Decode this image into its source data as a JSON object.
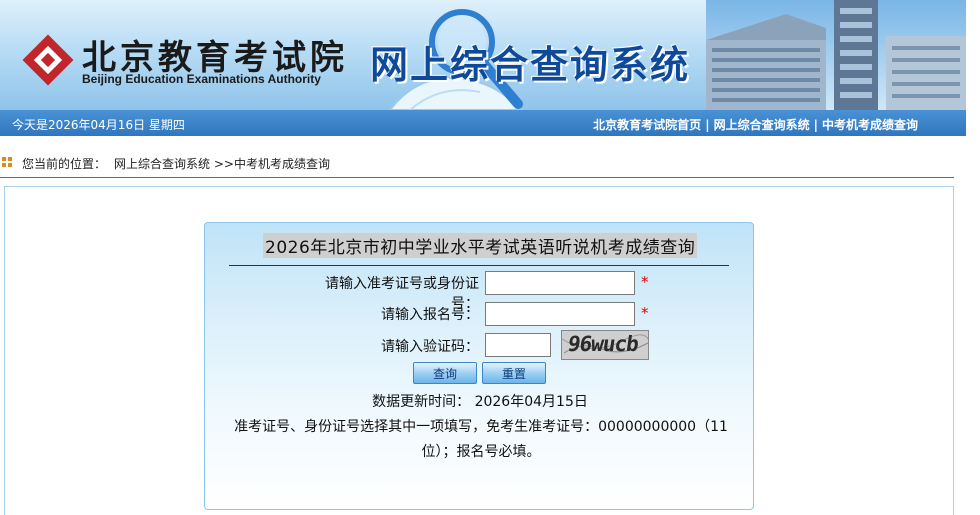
{
  "header": {
    "org_name_cn": "北京教育考试院",
    "org_name_en": "Beijing Education Examinations Authority",
    "system_title": "网上综合查询系统"
  },
  "topbar": {
    "date_text": "今天是2026年04月16日  星期四",
    "links": [
      "北京教育考试院首页",
      "网上综合查询系统",
      "中考机考成绩查询"
    ],
    "separator": "|"
  },
  "breadcrumb": {
    "lead": "您当前的位置：",
    "path": "网上综合查询系统 >>中考机考成绩查询"
  },
  "form": {
    "title": "2026年北京市初中学业水平考试英语听说机考成绩查询",
    "id_label": "请输入准考证号或身份证号：",
    "id_value": "",
    "reg_label": "请输入报名号：",
    "reg_value": "",
    "captcha_label": "请输入验证码：",
    "captcha_value": "",
    "captcha_image_text": "96wucb",
    "required_mark": "*",
    "query_button": "查询",
    "reset_button": "重置",
    "update_text": "数据更新时间：   2026年04月15日",
    "note_line1": "准考证号、身份证号选择其中一项填写，免考生准考证号：00000000000（11",
    "note_line2": "位）；报名号必填。"
  },
  "colors": {
    "bar_blue": "#2f76bf",
    "title_blue": "#0f4a9a",
    "required_red": "#e00000",
    "logo_red": "#c0262b"
  },
  "icons": {
    "logo": "bjeea-logo-icon",
    "breadcrumb": "grid-dots-icon"
  }
}
